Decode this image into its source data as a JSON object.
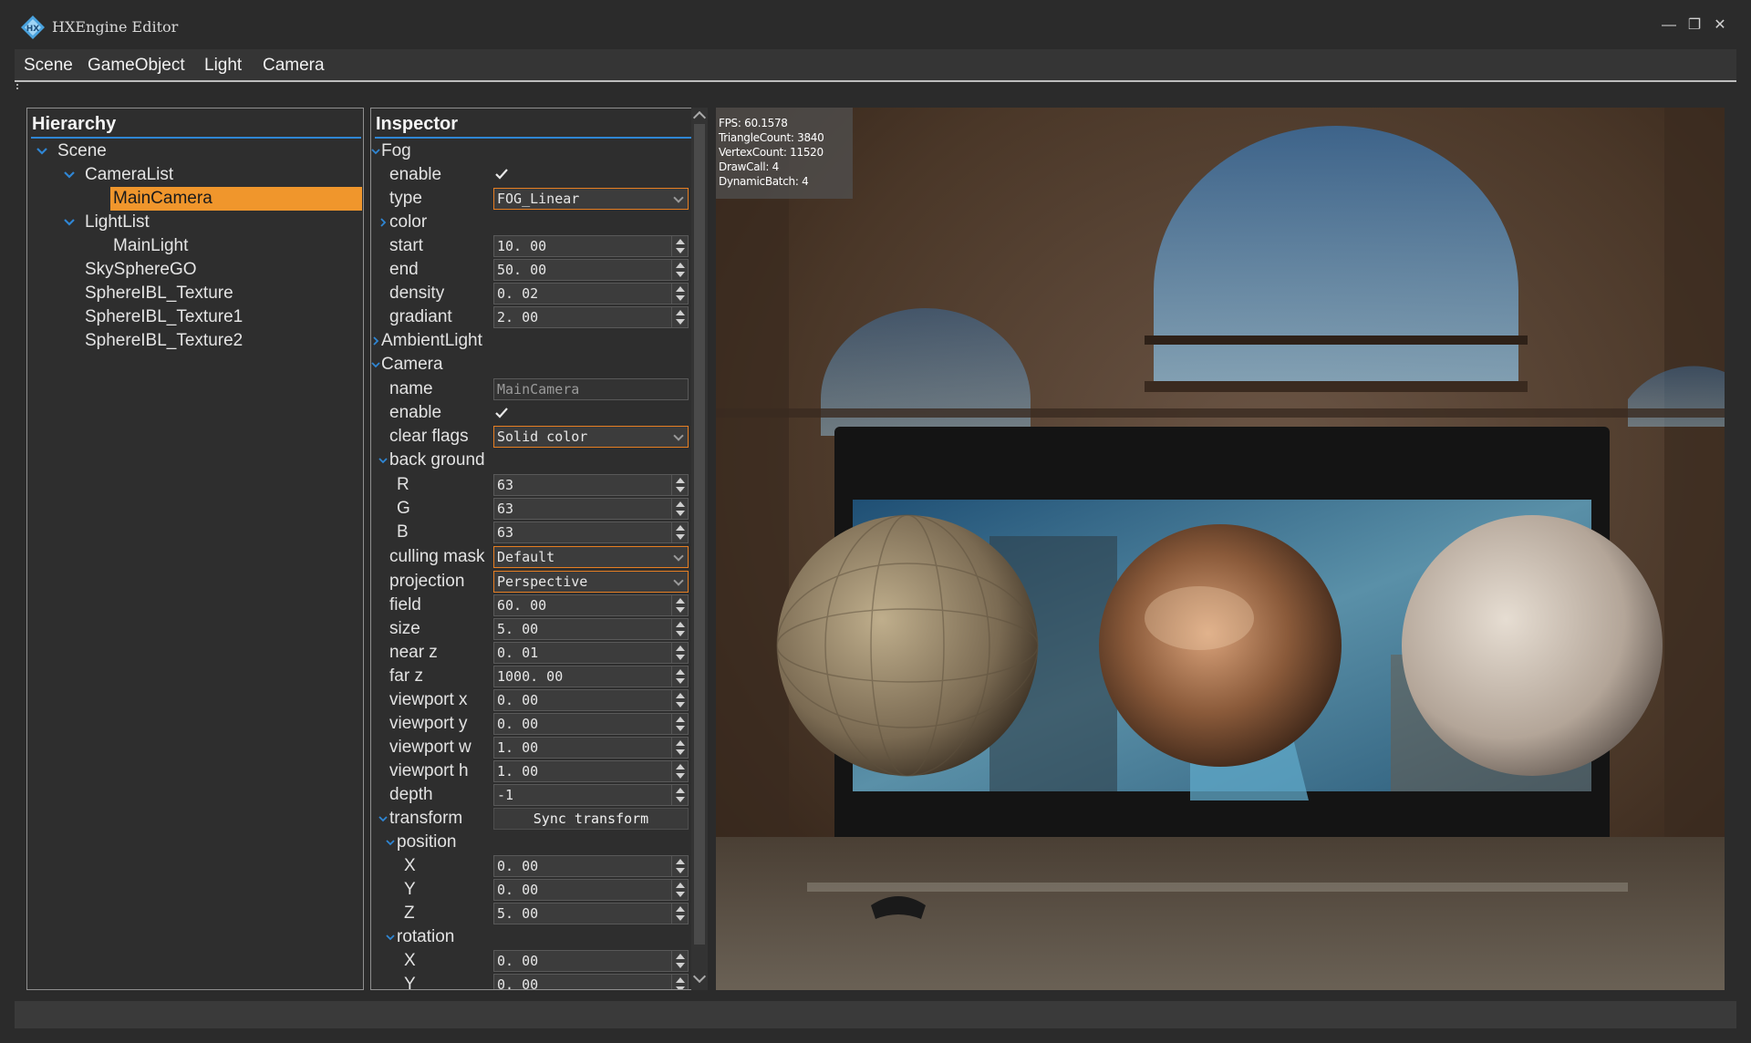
{
  "window": {
    "title": "HXEngine Editor"
  },
  "menu": [
    "Scene",
    "GameObject",
    "Light",
    "Camera"
  ],
  "hierarchy": {
    "title": "Hierarchy",
    "items": [
      {
        "label": "Scene",
        "expanded": true
      },
      {
        "label": "CameraList",
        "expanded": true
      },
      {
        "label": "MainCamera",
        "selected": true
      },
      {
        "label": "LightList",
        "expanded": true
      },
      {
        "label": "MainLight"
      },
      {
        "label": "SkySphereGO"
      },
      {
        "label": "SphereIBL_Texture"
      },
      {
        "label": "SphereIBL_Texture1"
      },
      {
        "label": "SphereIBL_Texture2"
      }
    ]
  },
  "inspector": {
    "title": "Inspector",
    "fog": {
      "label": "Fog",
      "enable_label": "enable",
      "enable": true,
      "type_label": "type",
      "type": "FOG_Linear",
      "color_label": "color",
      "start_label": "start",
      "start": "10. 00",
      "end_label": "end",
      "end": "50. 00",
      "density_label": "density",
      "density": "0. 02",
      "gradiant_label": "gradiant",
      "gradiant": "2. 00"
    },
    "ambient_label": "AmbientLight",
    "camera": {
      "label": "Camera",
      "name_label": "name",
      "name": "MainCamera",
      "enable_label": "enable",
      "enable": true,
      "clear_flags_label": "clear flags",
      "clear_flags": "Solid color",
      "background_label": "back ground",
      "r_label": "R",
      "r": "63",
      "g_label": "G",
      "g": "63",
      "b_label": "B",
      "b": "63",
      "culling_label": "culling mask",
      "culling": "Default",
      "projection_label": "projection",
      "projection": "Perspective",
      "field_label": "field",
      "field": "60. 00",
      "size_label": "size",
      "size": "5. 00",
      "nearz_label": "near z",
      "nearz": "0. 01",
      "farz_label": "far z",
      "farz": "1000. 00",
      "vpx_label": "viewport x",
      "vpx": "0. 00",
      "vpy_label": "viewport y",
      "vpy": "0. 00",
      "vpw_label": "viewport w",
      "vpw": "1. 00",
      "vph_label": "viewport h",
      "vph": "1. 00",
      "depth_label": "depth",
      "depth": "-1"
    },
    "transform": {
      "label": "transform",
      "sync_button": "Sync transform",
      "position_label": "position",
      "pos_x_label": "X",
      "pos_x": "0. 00",
      "pos_y_label": "Y",
      "pos_y": "0. 00",
      "pos_z_label": "Z",
      "pos_z": "5. 00",
      "rotation_label": "rotation",
      "rot_x_label": "X",
      "rot_x": "0. 00",
      "rot_y_label": "Y",
      "rot_y": "0. 00"
    }
  },
  "stats": {
    "fps": "FPS: 60.1578",
    "triangles": "TriangleCount: 3840",
    "vertices": "VertexCount: 11520",
    "drawcall": "DrawCall: 4",
    "dynamic": "DynamicBatch: 4"
  },
  "colors": {
    "accent": "#2f86d4",
    "selection": "#f0962c",
    "select_border": "#e67e22"
  }
}
